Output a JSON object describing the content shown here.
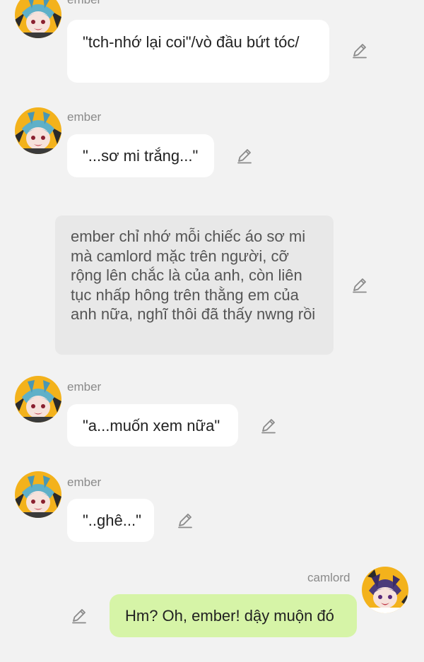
{
  "messages": [
    {
      "type": "incoming",
      "sender": "ember",
      "text": "\"tch-nhớ lại coi\"/vò đầu bứt tóc/"
    },
    {
      "type": "incoming",
      "sender": "ember",
      "text": "\"...sơ mi trắng...\""
    },
    {
      "type": "narration",
      "text": "ember chỉ nhớ mỗi chiếc áo sơ mi mà camlord mặc trên người, cỡ rộng lên chắc là của anh, còn liên tục nhấp hông trên thằng em của anh nữa, nghĩ thôi đã thấy nwng rồi"
    },
    {
      "type": "incoming",
      "sender": "ember",
      "text": "\"a...muốn xem nữa\""
    },
    {
      "type": "incoming",
      "sender": "ember",
      "text": "\"..ghê...\""
    },
    {
      "type": "outgoing",
      "sender": "camlord",
      "text": "Hm? Oh, ember! dậy muộn đó"
    }
  ],
  "colors": {
    "background": "#f2f2f2",
    "bubble": "#ffffff",
    "narration": "#e8e8e8",
    "own_bubble": "#d6f4a7",
    "sender": "#8a8a8a"
  },
  "icons": {
    "edit": "pencil-edit-icon",
    "ember_avatar": "ember-avatar",
    "camlord_avatar": "camlord-avatar"
  }
}
